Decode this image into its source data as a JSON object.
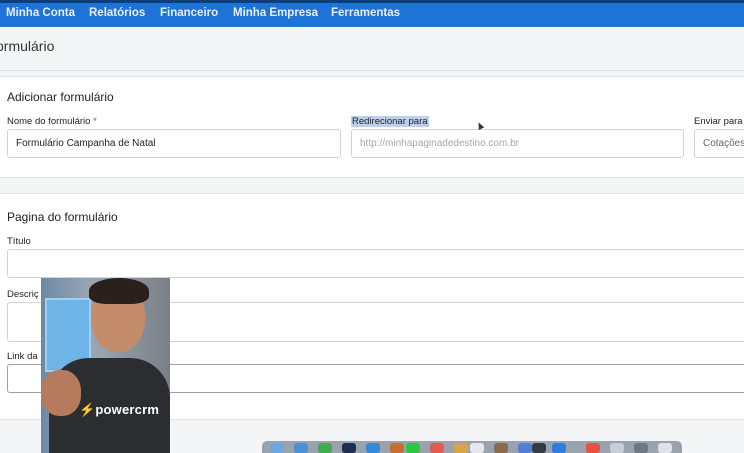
{
  "nav": {
    "items": [
      "Minha Conta",
      "Relatórios",
      "Financeiro",
      "Minha Empresa",
      "Ferramentas"
    ]
  },
  "page": {
    "title": "ormulário"
  },
  "section_add": {
    "title": "Adicionar formulário",
    "name_label": "Nome do formulário",
    "required_mark": "*",
    "name_value": "Formulário Campanha de Natal",
    "redirect_label": "Redirecionar para",
    "redirect_placeholder": "http://minhapaginadedestino.com.br",
    "send_label": "Enviar para o",
    "send_value": "Cotações"
  },
  "section_page": {
    "title": "Pagina do formulário",
    "title_label": "Título",
    "desc_label": "Descriç",
    "link_label": "Link da"
  },
  "webcam": {
    "logo_text": "powercrm"
  },
  "colors": {
    "nav_bg": "#1e73d8",
    "accent_dark": "#0f3d7a",
    "required": "#d0342c",
    "selection_highlight": "#bcd0ee"
  },
  "icons": {
    "cursor": "mouse-pointer-icon",
    "logo": "bolt-icon"
  }
}
